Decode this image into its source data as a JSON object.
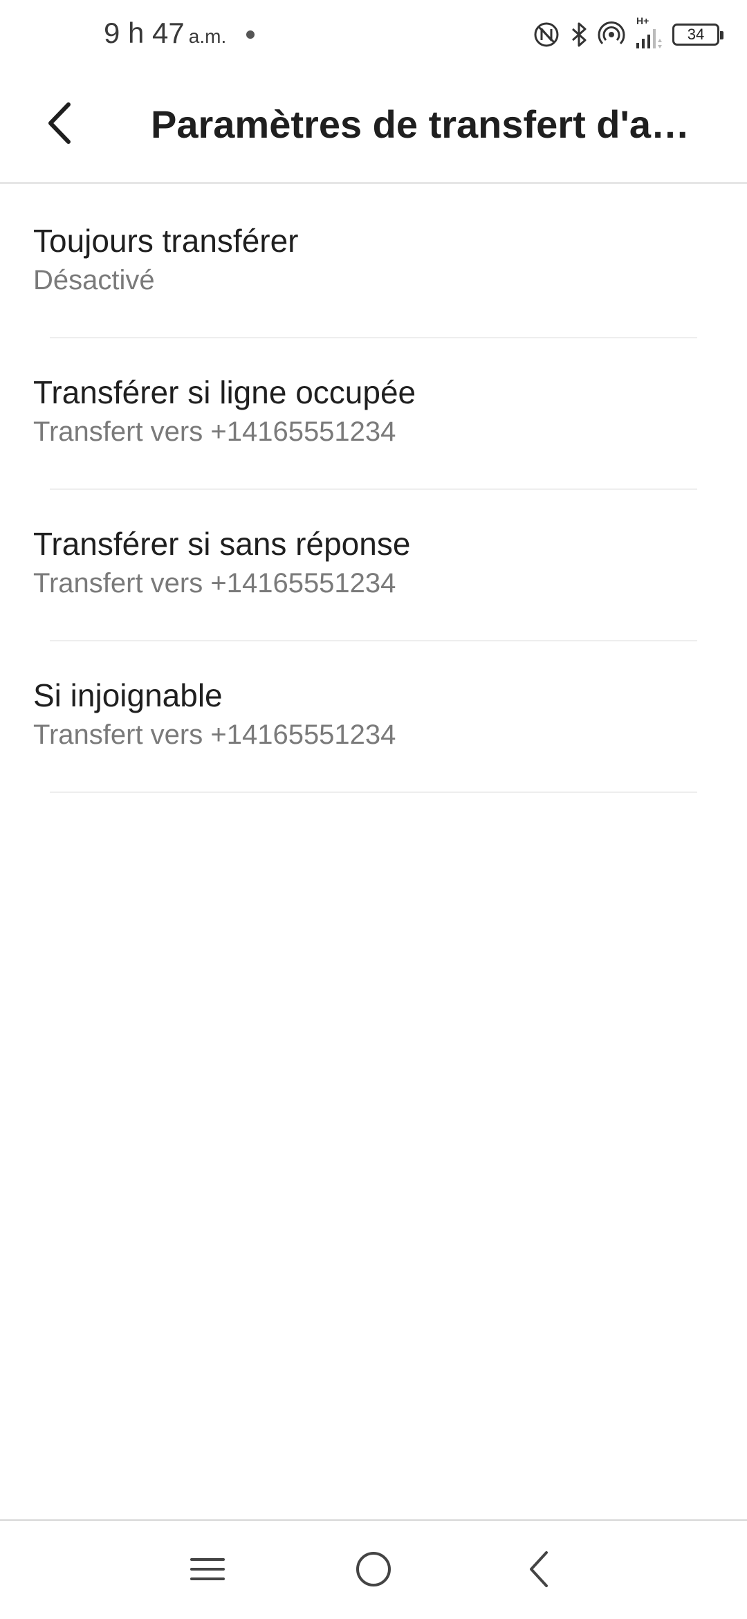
{
  "status_bar": {
    "time": "9 h 47",
    "ampm": "a.m.",
    "network_label": "H+",
    "battery_level": "34",
    "icons": [
      "nfc-icon",
      "bluetooth-icon",
      "hotspot-icon",
      "signal-icon",
      "battery-icon"
    ]
  },
  "app_bar": {
    "title": "Paramètres de transfert d'a…",
    "back_icon": "chevron-left-icon"
  },
  "settings": {
    "items": [
      {
        "title": "Toujours transférer",
        "subtitle": "Désactivé"
      },
      {
        "title": "Transférer si ligne occupée",
        "subtitle": "Transfert vers +14165551234"
      },
      {
        "title": "Transférer si sans réponse",
        "subtitle": "Transfert vers +14165551234"
      },
      {
        "title": "Si injoignable",
        "subtitle": "Transfert vers +14165551234"
      }
    ]
  },
  "nav_bar": {
    "icons": [
      "menu-icon",
      "home-icon",
      "back-icon"
    ]
  },
  "colors": {
    "text_primary": "#1f1f1f",
    "text_secondary": "#7a7a7a",
    "divider": "#eeeeee",
    "background": "#ffffff"
  }
}
